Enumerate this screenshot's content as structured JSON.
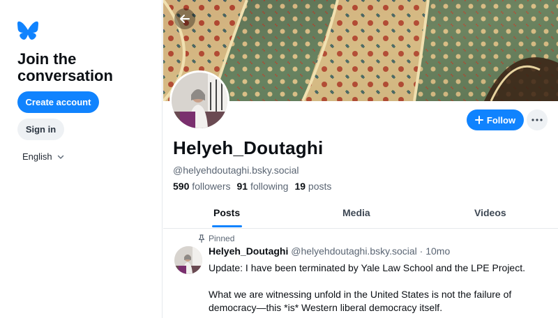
{
  "sidebar": {
    "logo_icon": "butterfly-icon",
    "join_title": "Join the conversation",
    "create_account_label": "Create account",
    "sign_in_label": "Sign in",
    "language_label": "English"
  },
  "profile": {
    "display_name": "Helyeh_Doutaghi",
    "handle": "@helyehdoutaghi.bsky.social",
    "followers_count": "590",
    "followers_label": "followers",
    "following_count": "91",
    "following_label": "following",
    "posts_count": "19",
    "posts_label": "posts",
    "follow_label": "Follow"
  },
  "tabs": [
    {
      "label": "Posts",
      "active": true
    },
    {
      "label": "Media",
      "active": false
    },
    {
      "label": "Videos",
      "active": false
    }
  ],
  "post": {
    "pinned_label": "Pinned",
    "author_name": "Helyeh_Doutaghi",
    "author_handle": "@helyehdoutaghi.bsky.social",
    "separator": "·",
    "age": "10mo",
    "paragraph_1": "Update: I have been terminated by Yale Law School and the LPE Project.",
    "paragraph_2": "What we are witnessing unfold in the United States is not the failure of democracy—this *is* Western liberal democracy itself."
  },
  "colors": {
    "accent": "#1083fe",
    "muted_text": "#5a6573",
    "border": "#e6e9ec"
  }
}
